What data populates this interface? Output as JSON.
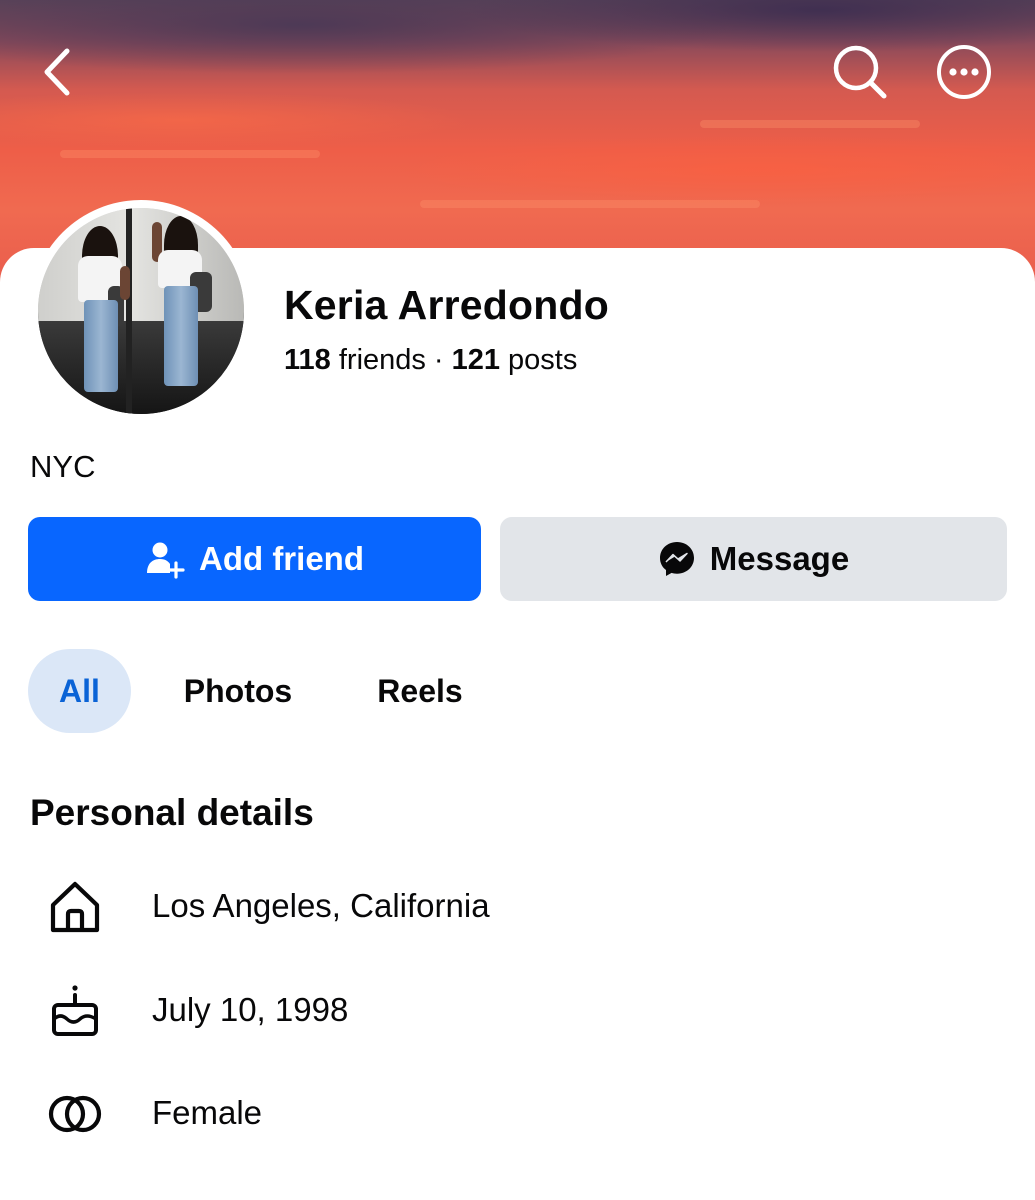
{
  "header": {
    "back_icon": "chevron-left-icon",
    "search_icon": "search-icon",
    "more_icon": "more-horizontal-icon"
  },
  "profile": {
    "name": "Keria Arredondo",
    "friends_count": "118",
    "friends_label": "friends",
    "separator": "·",
    "posts_count": "121",
    "posts_label": "posts",
    "bio": "NYC"
  },
  "actions": {
    "add_friend_label": "Add friend",
    "message_label": "Message"
  },
  "tabs": [
    {
      "label": "All",
      "active": true
    },
    {
      "label": "Photos",
      "active": false
    },
    {
      "label": "Reels",
      "active": false
    }
  ],
  "personal_details": {
    "title": "Personal details",
    "items": [
      {
        "icon": "home-icon",
        "text": "Los Angeles, California"
      },
      {
        "icon": "birthday-cake-icon",
        "text": "July 10, 1998"
      },
      {
        "icon": "gender-rings-icon",
        "text": "Female"
      }
    ]
  },
  "colors": {
    "primary_blue": "#0866ff",
    "secondary_gray": "#e2e5e9",
    "active_tab_bg": "#dbe7f7",
    "active_tab_text": "#0a63d6"
  }
}
